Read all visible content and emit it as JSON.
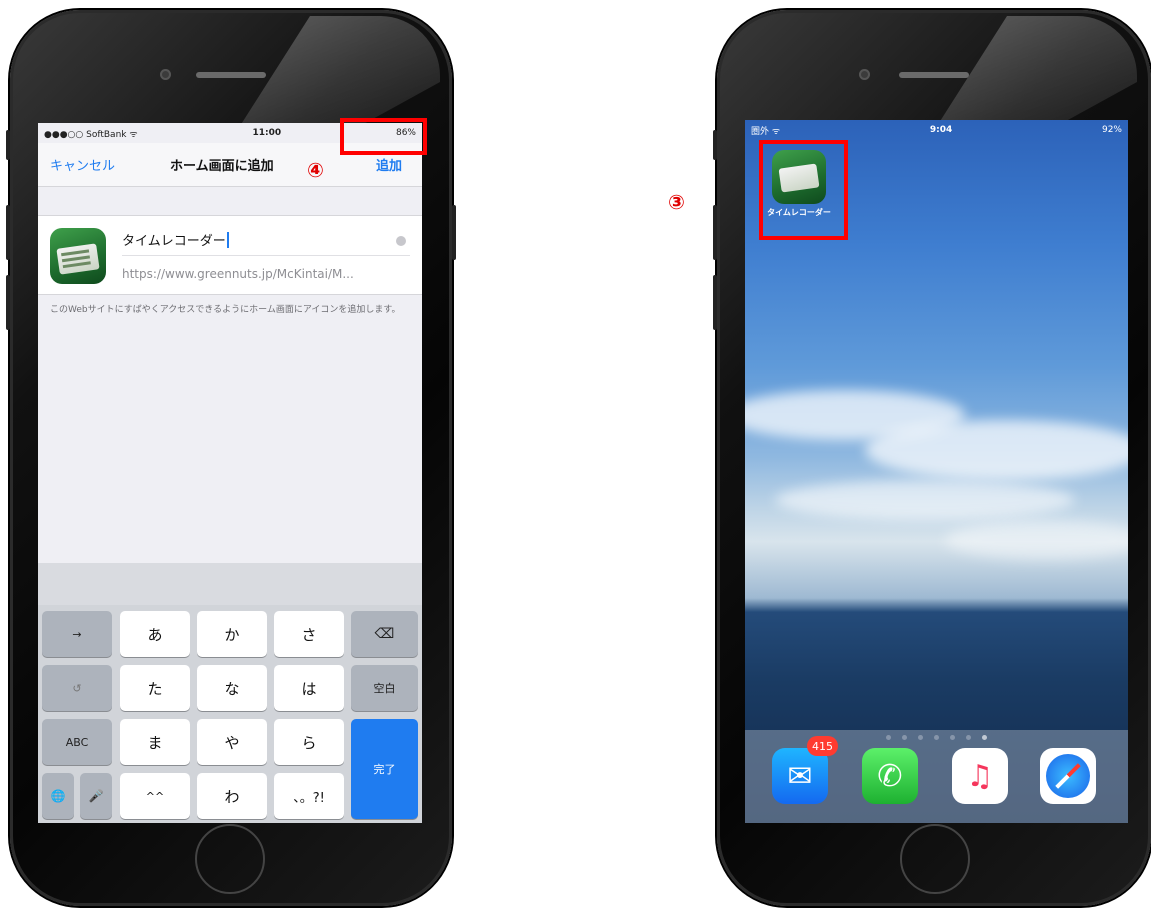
{
  "left_phone": {
    "status_bar": {
      "carrier": "●●●○○ SoftBank ᯤ",
      "time": "11:00",
      "battery": "86%"
    },
    "nav": {
      "cancel_label": "キャンセル",
      "title": "ホーム画面に追加",
      "add_label": "追加"
    },
    "step_marker": "④",
    "form": {
      "app_name_value": "タイムレコーダー",
      "url_value": "https://www.greennuts.jp/McKintai/M...",
      "description": "このWebサイトにすばやくアクセスできるようにホーム画面にアイコンを追加します。"
    },
    "keyboard": {
      "row1": [
        "→",
        "あ",
        "か",
        "さ",
        "⌫"
      ],
      "row2": [
        "↺",
        "た",
        "な",
        "は",
        "空白"
      ],
      "row3": [
        "ABC",
        "ま",
        "や",
        "ら"
      ],
      "row4": [
        "🌐",
        "🎤",
        "^^",
        "わ",
        "、。?!"
      ],
      "done_label": "完了"
    }
  },
  "right_phone": {
    "status_bar": {
      "carrier": "圏外 ᯤ",
      "time": "9:04",
      "battery": "92%"
    },
    "step_marker": "③",
    "home_icon_label": "タイムレコーダー",
    "page_dots": 7,
    "active_dot": 7,
    "dock": {
      "mail_badge": "415"
    }
  },
  "colors": {
    "accent_blue": "#1f7cf0",
    "highlight_red": "#ff0000",
    "badge_red": "#ff3b30"
  }
}
